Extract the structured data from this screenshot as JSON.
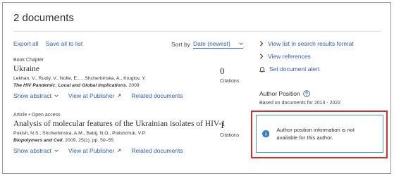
{
  "header": {
    "title": "2 documents"
  },
  "toolbar": {
    "export_all": "Export all",
    "save_all": "Save all to list",
    "sort_label": "Sort by",
    "sort_value": "Date (newest)"
  },
  "side_links": [
    {
      "label": "View list in search results format"
    },
    {
      "label": "View references"
    },
    {
      "label": "Set document alert"
    }
  ],
  "documents": [
    {
      "type": "Book Chapter",
      "title": "Ukraine",
      "authors": "Lekhan, V., Rudiy, V., Nolte, E., ...Shcherbinska, A., Kruglov, Y.",
      "source_name": "The HIV Pandemic: Local and Global Implications",
      "source_rest": ", 2009",
      "citations": "0",
      "citations_label": "Citations",
      "show_abstract": "Show abstract",
      "view_publisher": "View at Publisher",
      "related": "Related documents"
    },
    {
      "type": "Article  •  Open access",
      "title": "Analysis of molecular features of the Ukrainian isolates of HIV-1",
      "authors": "Pukish, N.S., Shcherbinska, A.M., Babij, N.O., Polishchuk, V.P.",
      "source_name": "Biopolymers and Cell",
      "source_rest": ", 2009, 25(1), pp. 50–55",
      "citations": "1",
      "citations_label": "Citations",
      "show_abstract": "Show abstract",
      "view_publisher": "View at Publisher",
      "related": "Related documents"
    }
  ],
  "author_position": {
    "title": "Author Position",
    "subtitle": "Based on documents for 2013 - 2022",
    "info_text": "Author position information is not available for this author."
  },
  "colors": {
    "link": "#2e5fb6",
    "highlight": "#d32f2f",
    "info_border": "#4a9ed6",
    "info_icon": "#2f7fc1"
  }
}
